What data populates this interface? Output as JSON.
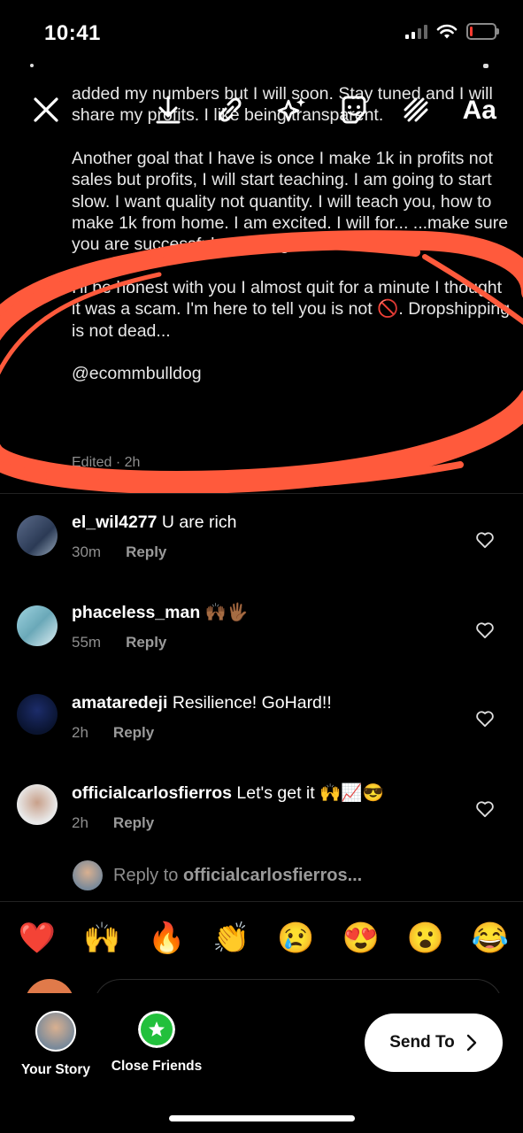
{
  "status_bar": {
    "time": "10:41"
  },
  "toolbar": {
    "text_tool": "Aa"
  },
  "caption": {
    "paragraphs": [
      "added my numbers but I will soon. Stay tuned and I will share my profits. I like being transparent.",
      "Another goal that I have is once I make 1k in profits not sales but profits, I will start teaching. I am going to start slow. I want quality not quantity. I will teach you, how to make 1k from home. I am excited. I will for... ...make sure you are successful ...moving forward.",
      "I'll be honest with you I almost quit for a minute I thought it was a scam. I'm here to tell you is not 🚫. Dropshipping is not dead...",
      "@ecommbulldog"
    ],
    "edited": "Edited · 2h"
  },
  "comments": [
    {
      "username": "el_wil4277",
      "text": "U are rich",
      "time": "30m",
      "reply": "Reply"
    },
    {
      "username": "phaceless_man",
      "text": "🙌🏾🖐🏾",
      "time": "55m",
      "reply": "Reply"
    },
    {
      "username": "amataredeji",
      "text": "Resilience! GoHard!!",
      "time": "2h",
      "reply": "Reply"
    },
    {
      "username": "officialcarlosfierros",
      "text": "Let's get it 🙌📈😎",
      "time": "2h",
      "reply": "Reply"
    }
  ],
  "reply_to": {
    "prefix": "Reply to ",
    "username": "officialcarlosfierros..."
  },
  "reactions": [
    "❤️",
    "🙌",
    "🔥",
    "👏",
    "😢",
    "😍",
    "😮",
    "😂"
  ],
  "share": {
    "your_story": "Your Story",
    "close_friends": "Close Friends",
    "send_to": "Send To"
  },
  "colors": {
    "accent_green": "#22c03c",
    "annotation_red": "#ff5a3c",
    "battery_red": "#ff3b30"
  },
  "battery_level_percent": 10
}
